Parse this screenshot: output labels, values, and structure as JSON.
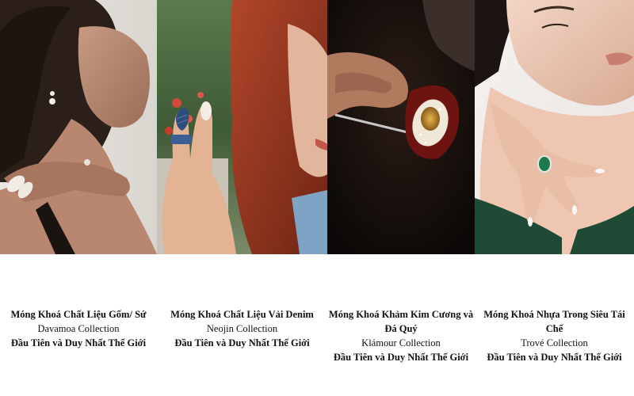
{
  "products": [
    {
      "title": "Móng Khoá Chất Liệu Gốm/ Sứ",
      "collection": "Davamoa Collection",
      "tagline": "Đầu Tiên và Duy Nhất Thế Giới"
    },
    {
      "title": "Móng Khoá Chất Liệu Vải Denim",
      "collection": "Neojin Collection",
      "tagline": "Đầu Tiên và Duy Nhất Thế Giới"
    },
    {
      "title": "Móng Khoá Khảm Kim Cương và Đá Quý",
      "collection": "Klámour Collection",
      "tagline": "Đầu Tiên và Duy Nhất Thế Giới"
    },
    {
      "title": "Móng Khoá Nhựa Trong Siêu Tái Chế",
      "collection": "Trové Collection",
      "tagline": "Đầu Tiên và Duy Nhất Thế Giới"
    }
  ]
}
